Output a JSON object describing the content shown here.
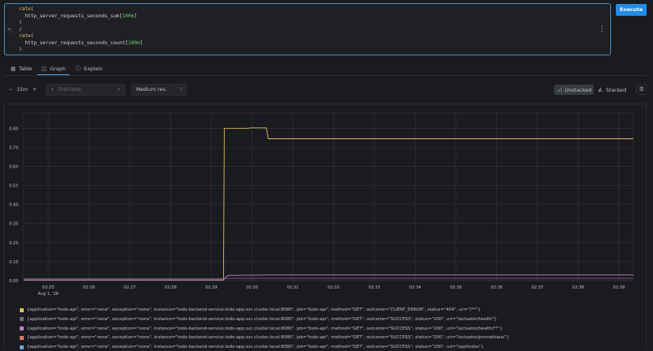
{
  "query": {
    "lines": [
      [
        {
          "t": "rate",
          "c": "fn"
        },
        {
          "t": "(",
          "c": ""
        }
      ],
      [
        {
          "t": "  http_server_requests_seconds_sum[",
          "c": ""
        },
        {
          "t": "100m",
          "c": "num"
        },
        {
          "t": "]",
          "c": ""
        }
      ],
      [
        {
          "t": ")",
          "c": ""
        }
      ],
      [
        {
          "t": "/",
          "c": ""
        }
      ],
      [
        {
          "t": "rate",
          "c": "fn"
        },
        {
          "t": "(",
          "c": ""
        }
      ],
      [
        {
          "t": "  http_server_requests_seconds_count[",
          "c": ""
        },
        {
          "t": "100m",
          "c": "num"
        },
        {
          "t": "]",
          "c": ""
        }
      ],
      [
        {
          "t": ")",
          "c": ""
        }
      ]
    ],
    "prompt": ">_",
    "menu": "⋮",
    "execute_label": "Execute"
  },
  "tabs": [
    {
      "label": "Table",
      "icon": "table-icon",
      "active": false
    },
    {
      "label": "Graph",
      "icon": "graph-icon",
      "active": true
    },
    {
      "label": "Explain",
      "icon": "explain-icon",
      "active": false
    }
  ],
  "controls": {
    "minus": "−",
    "range": "15m",
    "plus": "+",
    "end_time_placeholder": "End time",
    "resolution": "Medium res.",
    "unstacked_label": "Unstacked",
    "stacked_label": "Stacked",
    "mode": "unstacked"
  },
  "colors": {
    "accent": "#228be6",
    "series": [
      "#e0c060",
      "#6c6e73",
      "#c080d0",
      "#e07a5f",
      "#60a5fa",
      "#a3c060"
    ]
  },
  "chart_data": {
    "type": "line",
    "x_ticks": [
      "02:25",
      "02:26",
      "02:27",
      "02:28",
      "02:29",
      "02:30",
      "02:31",
      "02:32",
      "02:33",
      "02:34",
      "02:35",
      "02:36",
      "02:37",
      "02:38",
      "02:39"
    ],
    "x_sub_label": "Aug 1, '26",
    "xlim": [
      0,
      14.95
    ],
    "ylim": [
      0,
      0.88
    ],
    "y_ticks": [
      0,
      0.1,
      0.2,
      0.3,
      0.4,
      0.5,
      0.6,
      0.7,
      0.8
    ],
    "y_tick_labels": [
      "0.00",
      "0.10",
      "0.20",
      "0.30",
      "0.40",
      "0.50",
      "0.60",
      "0.70",
      "0.80"
    ],
    "grid": true,
    "series": [
      {
        "color": "#e0c060",
        "points": [
          [
            0,
            0.003
          ],
          [
            4.9,
            0.003
          ],
          [
            4.92,
            0.8
          ],
          [
            5.5,
            0.8
          ],
          [
            5.55,
            0.802
          ],
          [
            5.95,
            0.802
          ],
          [
            6.0,
            0.745
          ],
          [
            14.95,
            0.745
          ]
        ]
      },
      {
        "color": "#6c6e73",
        "points": [
          [
            0,
            0.01
          ],
          [
            4.9,
            0.01
          ],
          [
            5.0,
            0.012
          ],
          [
            14.95,
            0.012
          ]
        ]
      },
      {
        "color": "#c080d0",
        "points": [
          [
            0,
            0.004
          ],
          [
            4.9,
            0.004
          ],
          [
            5.0,
            0.028
          ],
          [
            6.0,
            0.03
          ],
          [
            14.95,
            0.03
          ]
        ]
      }
    ]
  },
  "legend": [
    {
      "color": "#e0c060",
      "label": "{application=\"todo-api\", error=\"none\", exception=\"none\", instance=\"todo-backend-service.todo-app.svc.cluster.local:8080\", job=\"todo-api\", method=\"GET\", outcome=\"CLIENT_ERROR\", status=\"404\", uri=\"/**\"}"
    },
    {
      "color": "#6c6e73",
      "label": "{application=\"todo-api\", error=\"none\", exception=\"none\", instance=\"todo-backend-service.todo-app.svc.cluster.local:8080\", job=\"todo-api\", method=\"GET\", outcome=\"SUCCESS\", status=\"200\", uri=\"/actuator/health\"}"
    },
    {
      "color": "#c080d0",
      "label": "{application=\"todo-api\", error=\"none\", exception=\"none\", instance=\"todo-backend-service.todo-app.svc.cluster.local:8080\", job=\"todo-api\", method=\"GET\", outcome=\"SUCCESS\", status=\"200\", uri=\"/actuator/health/**\"}"
    },
    {
      "color": "#e07a5f",
      "label": "{application=\"todo-api\", error=\"none\", exception=\"none\", instance=\"todo-backend-service.todo-app.svc.cluster.local:8080\", job=\"todo-api\", method=\"GET\", outcome=\"SUCCESS\", status=\"200\", uri=\"/actuator/prometheus\"}"
    },
    {
      "color": "#60a5fa",
      "label": "{application=\"todo-api\", error=\"none\", exception=\"none\", instance=\"todo-backend-service.todo-app.svc.cluster.local:8080\", job=\"todo-api\", method=\"GET\", outcome=\"SUCCESS\", status=\"200\", uri=\"/api/todos\"}"
    }
  ]
}
